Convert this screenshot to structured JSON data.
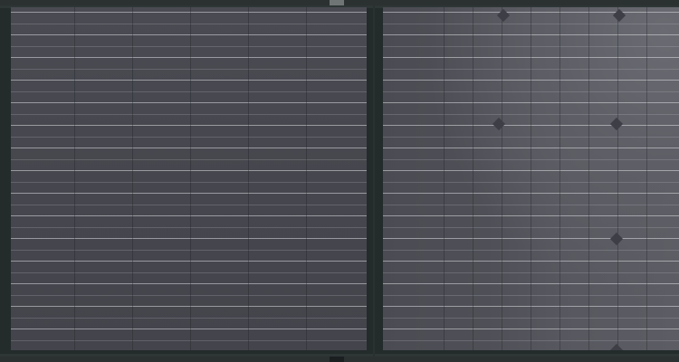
{
  "scene": {
    "subject": "",
    "colors": {
      "frame": "#232b2b",
      "cell": "#4a4b52",
      "highlight": "#6a6b72"
    }
  }
}
